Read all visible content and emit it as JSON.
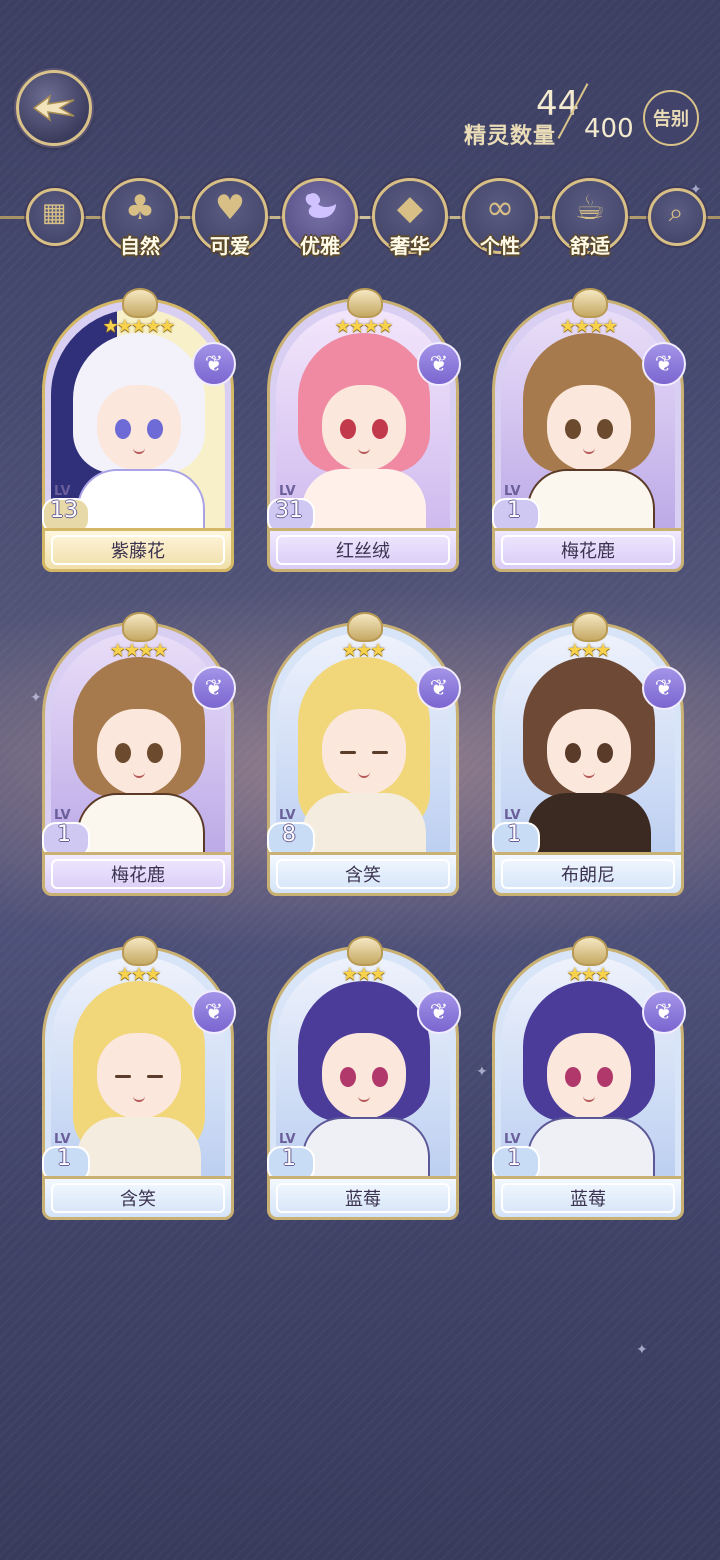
{
  "header": {
    "counter_label": "精灵数量",
    "count_current": "44",
    "count_max": "400",
    "farewell_label": "告别"
  },
  "filters": [
    {
      "id": "all",
      "label": "",
      "icon": "grid-icon"
    },
    {
      "id": "nature",
      "label": "自然",
      "icon": "clover-icon"
    },
    {
      "id": "cute",
      "label": "可爱",
      "icon": "heart-icon"
    },
    {
      "id": "elegant",
      "label": "优雅",
      "icon": "swan-icon",
      "active": true
    },
    {
      "id": "luxury",
      "label": "奢华",
      "icon": "diamond-icon"
    },
    {
      "id": "personality",
      "label": "个性",
      "icon": "glasses-icon"
    },
    {
      "id": "comfort",
      "label": "舒适",
      "icon": "teacup-icon"
    },
    {
      "id": "search",
      "label": "",
      "icon": "search-icon"
    }
  ],
  "cards": [
    {
      "name": "紫藤花",
      "lv_tag": "LV",
      "level": "13",
      "stars": 5,
      "theme": "gold",
      "attr_icon": "swan-icon"
    },
    {
      "name": "红丝绒",
      "lv_tag": "LV",
      "level": "31",
      "stars": 4,
      "theme": "purple",
      "attr_icon": "swan-icon"
    },
    {
      "name": "梅花鹿",
      "lv_tag": "LV",
      "level": "1",
      "stars": 4,
      "theme": "purple",
      "attr_icon": "swan-icon"
    },
    {
      "name": "梅花鹿",
      "lv_tag": "LV",
      "level": "1",
      "stars": 4,
      "theme": "purple",
      "attr_icon": "swan-icon"
    },
    {
      "name": "含笑",
      "lv_tag": "LV",
      "level": "8",
      "stars": 3,
      "theme": "blue",
      "attr_icon": "swan-icon"
    },
    {
      "name": "布朗尼",
      "lv_tag": "LV",
      "level": "1",
      "stars": 3,
      "theme": "blue",
      "attr_icon": "swan-icon"
    },
    {
      "name": "含笑",
      "lv_tag": "LV",
      "level": "1",
      "stars": 3,
      "theme": "blue",
      "attr_icon": "swan-icon"
    },
    {
      "name": "蓝莓",
      "lv_tag": "LV",
      "level": "1",
      "stars": 3,
      "theme": "blue",
      "attr_icon": "swan-icon"
    },
    {
      "name": "蓝莓",
      "lv_tag": "LV",
      "level": "1",
      "stars": 3,
      "theme": "blue",
      "attr_icon": "swan-icon"
    }
  ],
  "colors": {
    "gold": "#d9c38a",
    "accent_purple": "#8f7fe0",
    "star": "#f7d24a"
  }
}
